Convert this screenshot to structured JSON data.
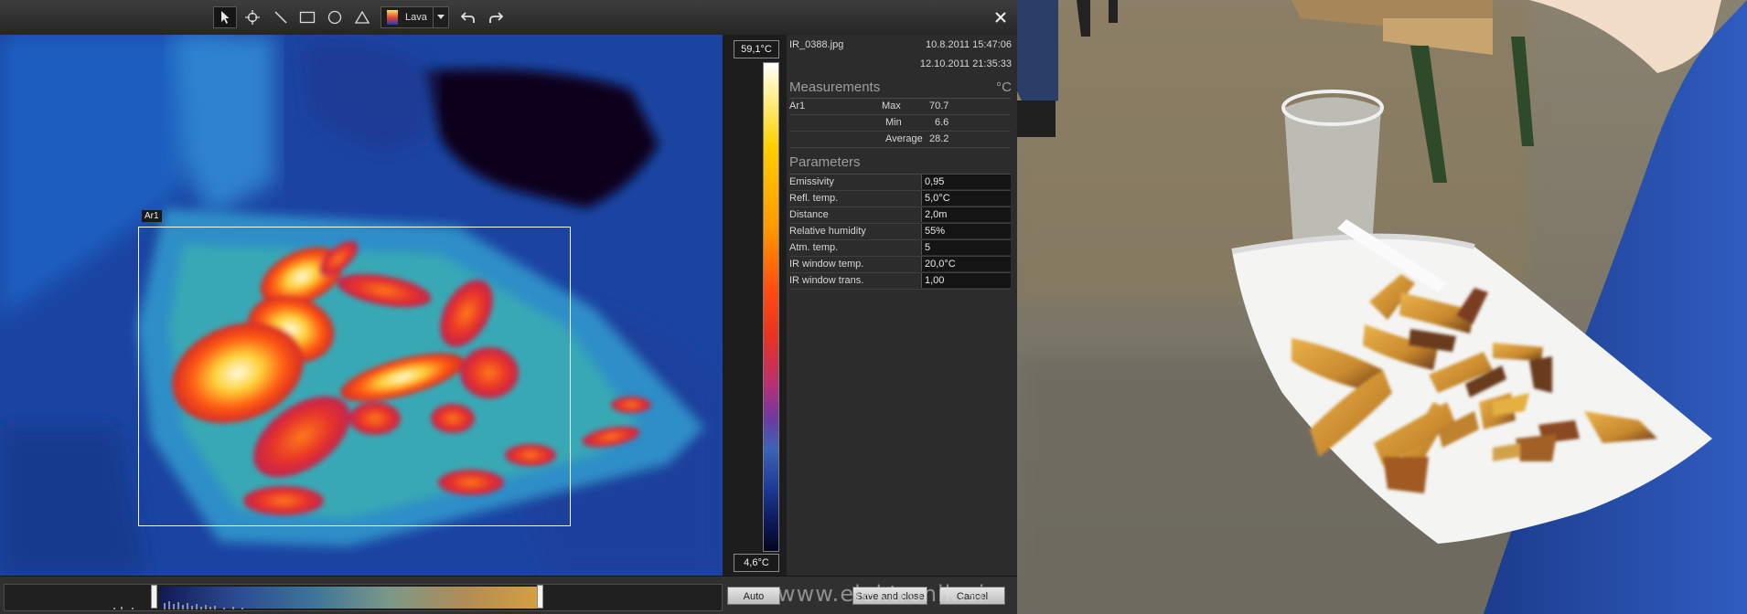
{
  "toolbar": {
    "tools": [
      {
        "name": "select-tool",
        "icon": "arrow-pointer-icon"
      },
      {
        "name": "spot-tool",
        "icon": "crosshair-icon"
      },
      {
        "name": "line-tool",
        "icon": "line-icon"
      },
      {
        "name": "rectangle-tool",
        "icon": "rectangle-icon"
      },
      {
        "name": "circle-tool",
        "icon": "circle-icon"
      },
      {
        "name": "triangle-tool",
        "icon": "triangle-icon"
      }
    ],
    "palette_label": "Lava",
    "undo_icon": "undo-icon",
    "redo_icon": "redo-icon",
    "close_icon": "close-icon"
  },
  "thermal": {
    "area_label": "Ar1",
    "scale_max": "59,1°C",
    "scale_min": "4,6°C"
  },
  "info": {
    "filename": "IR_0388.jpg",
    "date_taken": "10.8.2011 15:47:06",
    "date_modified": "12.10.2011 21:35:33",
    "measurements_title": "Measurements",
    "unit": "°C",
    "measurements": [
      {
        "area": "Ar1",
        "label": "Max",
        "value": "70.7"
      },
      {
        "area": "",
        "label": "Min",
        "value": "6.6"
      },
      {
        "area": "",
        "label": "Average",
        "value": "28.2"
      }
    ],
    "parameters_title": "Parameters",
    "parameters": [
      {
        "label": "Emissivity",
        "value": "0,95"
      },
      {
        "label": "Refl. temp.",
        "value": "5,0°C"
      },
      {
        "label": "Distance",
        "value": "2,0m"
      },
      {
        "label": "Relative humidity",
        "value": "55%"
      },
      {
        "label": "Atm. temp.",
        "value": "5"
      },
      {
        "label": "IR window temp.",
        "value": "20,0°C"
      },
      {
        "label": "IR window trans.",
        "value": "1,00"
      }
    ]
  },
  "bottom": {
    "auto_label": "Auto",
    "save_label": "Save and close",
    "cancel_label": "Cancel",
    "watermark": "www.elektronik.si"
  },
  "colors": {
    "toolbar_bg": "#2f2f2f",
    "panel_bg": "#2c2c2c",
    "thermal_blue": "#19409a",
    "hot_yellow": "#fff4a0",
    "hot_red": "#e83322"
  }
}
